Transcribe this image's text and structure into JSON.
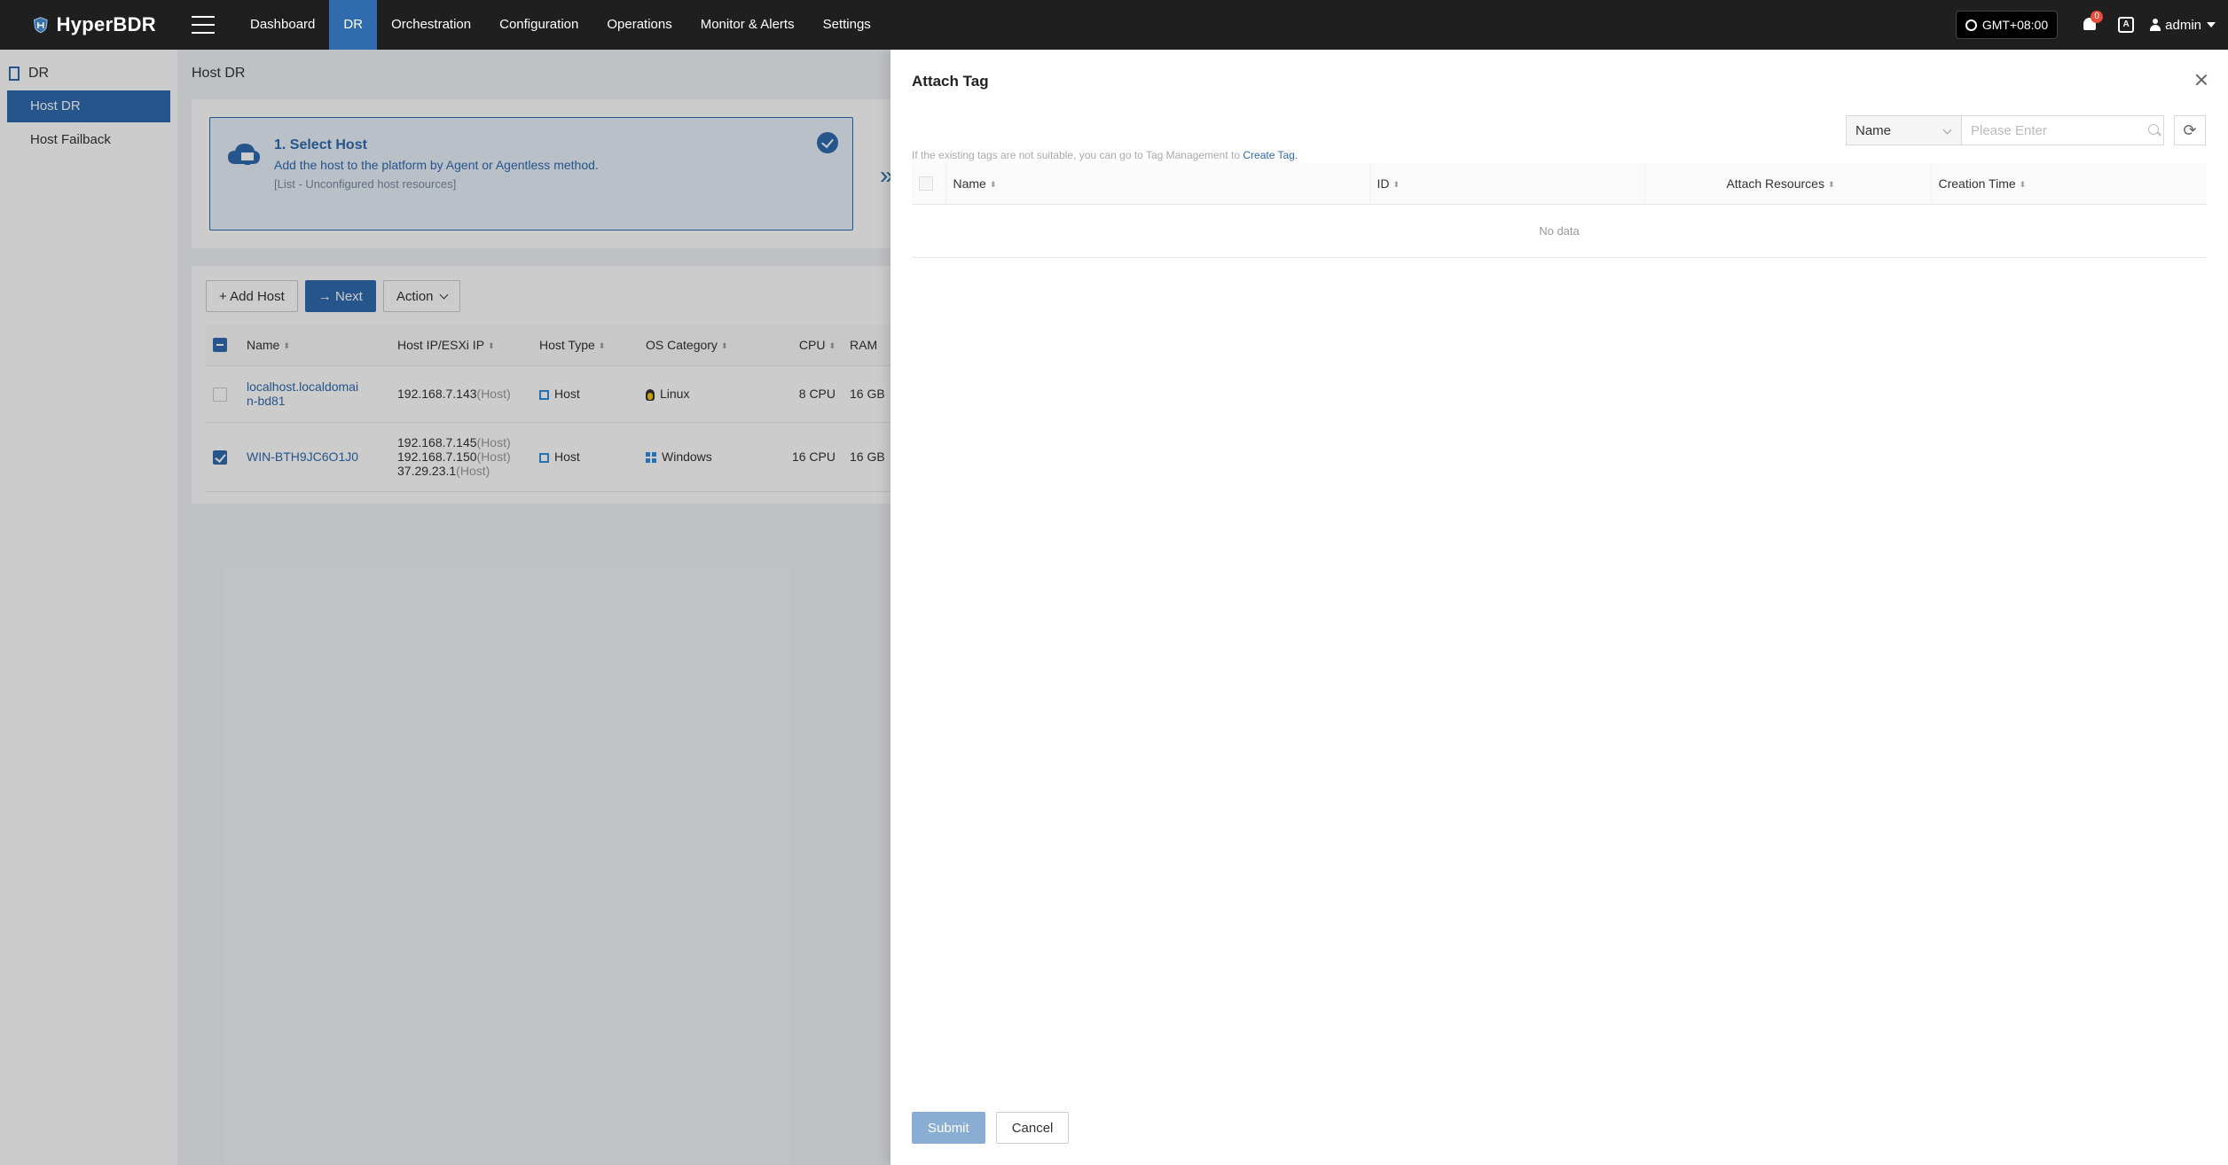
{
  "app": {
    "name": "HyperBDR"
  },
  "nav": {
    "items": [
      {
        "label": "Dashboard",
        "active": false
      },
      {
        "label": "DR",
        "active": true
      },
      {
        "label": "Orchestration",
        "active": false
      },
      {
        "label": "Configuration",
        "active": false
      },
      {
        "label": "Operations",
        "active": false
      },
      {
        "label": "Monitor & Alerts",
        "active": false
      },
      {
        "label": "Settings",
        "active": false
      }
    ],
    "timezone": "GMT+08:00",
    "notification_count": "0",
    "lang_icon": "A",
    "user": "admin"
  },
  "sidebar": {
    "group": "DR",
    "items": [
      {
        "label": "Host DR",
        "active": true
      },
      {
        "label": "Host Failback",
        "active": false
      }
    ]
  },
  "main": {
    "page_title": "Host DR",
    "step": {
      "title": "1. Select Host",
      "desc": "Add the host to the platform by Agent or Agentless method.",
      "hint": "[List - Unconfigured host resources]",
      "arrow": "»"
    },
    "toolbar": {
      "add_host": "+ Add Host",
      "next": "→ Next",
      "action": "Action"
    },
    "table": {
      "columns": [
        "Name",
        "Host IP/ESXi IP",
        "Host Type",
        "OS Category",
        "CPU",
        "RAM"
      ],
      "rows": [
        {
          "checked": false,
          "name_line1": "localhost.localdomai",
          "name_line2": "n-bd81",
          "ips": [
            {
              "ip": "192.168.7.143",
              "tag": "(Host)"
            }
          ],
          "host_type": "Host",
          "os": "Linux",
          "cpu": "8 CPU",
          "ram": "16 GB"
        },
        {
          "checked": true,
          "name_line1": "WIN-BTH9JC6O1J0",
          "name_line2": "",
          "ips": [
            {
              "ip": "192.168.7.145",
              "tag": "(Host)"
            },
            {
              "ip": "192.168.7.150",
              "tag": "(Host)"
            },
            {
              "ip": "37.29.23.1",
              "tag": "(Host)"
            }
          ],
          "host_type": "Host",
          "os": "Windows",
          "cpu": "16 CPU",
          "ram": "16 GB"
        }
      ]
    }
  },
  "drawer": {
    "title": "Attach Tag",
    "search_field": "Name",
    "search_placeholder": "Please Enter",
    "refresh_icon": "⟳",
    "hint_text": "If the existing tags are not suitable, you can go to Tag Management to ",
    "hint_link": "Create Tag.",
    "columns": [
      "Name",
      "ID",
      "Attach Resources",
      "Creation Time"
    ],
    "empty_text": "No data",
    "submit": "Submit",
    "cancel": "Cancel"
  }
}
